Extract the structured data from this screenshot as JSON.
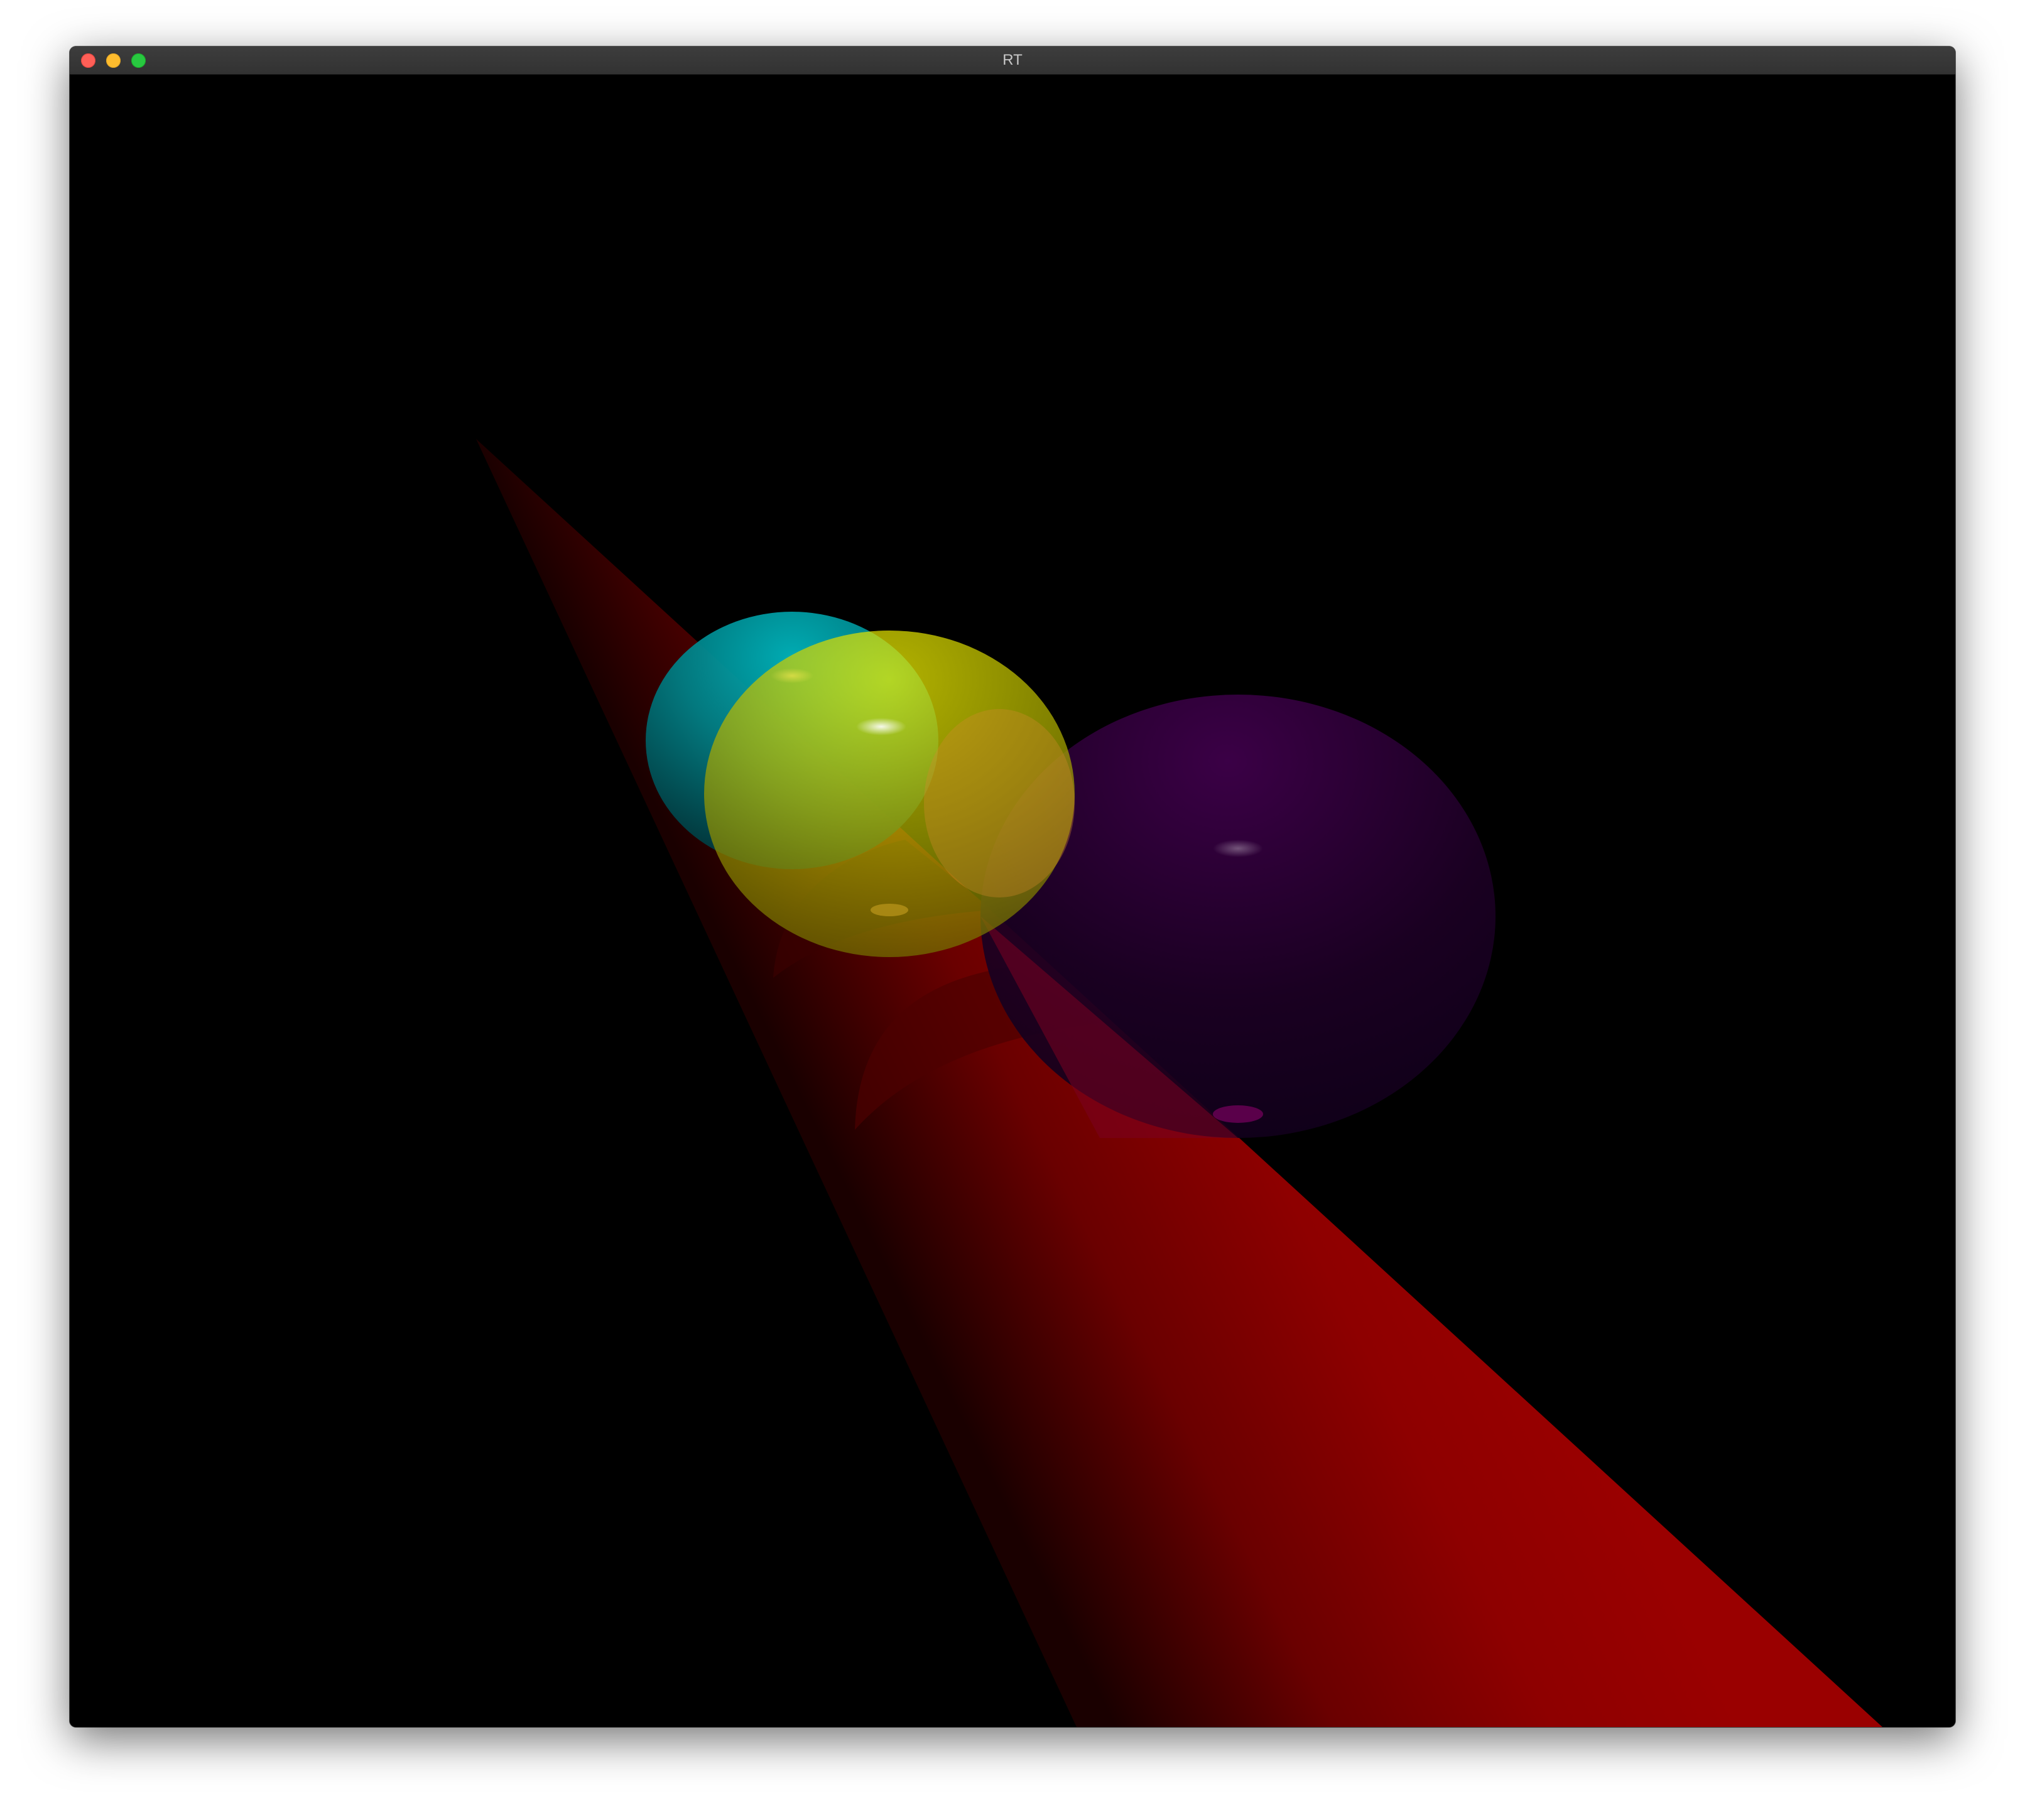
{
  "window": {
    "title": "RT",
    "controls": {
      "close": "close-button",
      "minimize": "minimize-button",
      "zoom": "zoom-button"
    }
  },
  "scene": {
    "background": "#000000",
    "cone_color": "#990000",
    "sphere_colors": {
      "cyan": "#00a0a8",
      "yellow": "#f2f200",
      "purple": "#3a0045"
    }
  }
}
